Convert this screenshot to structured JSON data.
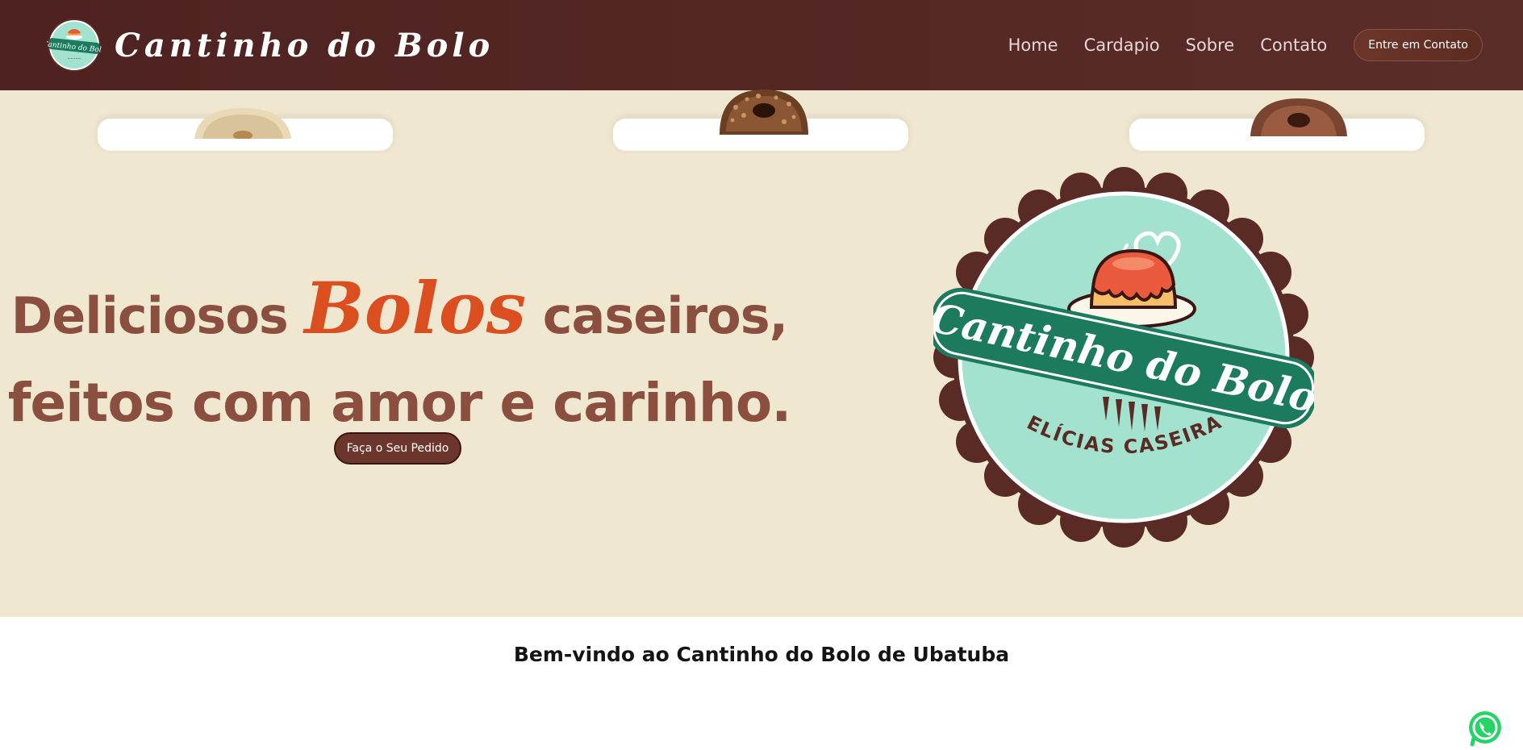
{
  "header": {
    "brand_name": "Cantinho do Bolo",
    "logo_text": "Cantinho do Bolo",
    "nav": [
      {
        "label": "Home"
      },
      {
        "label": "Cardapio"
      },
      {
        "label": "Sobre"
      },
      {
        "label": "Contato"
      }
    ],
    "cta_label": "Entre em Contato"
  },
  "hero": {
    "title_part1": "Deliciosos",
    "title_accent": "Bolos",
    "title_part2": "caseiros,",
    "title_line2": "feitos com amor e carinho.",
    "button_label": "Faça o Seu Pedido",
    "logo": {
      "name": "Cantinho do Bolo",
      "tagline": "DELÍCIAS CASEIRAS"
    }
  },
  "welcome": {
    "title": "Bem-vindo ao Cantinho do Bolo de Ubatuba"
  },
  "icons": {
    "whatsapp": "whatsapp-icon"
  },
  "colors": {
    "header_bg": "#4e2220",
    "hero_bg": "#f0e7d0",
    "hero_text": "#8a4f3f",
    "accent": "#db4e1f",
    "logo_mint": "#a3e2cf",
    "logo_banner": "#1c7a5f",
    "logo_ring": "#5a2b24",
    "whatsapp_green": "#25d366"
  }
}
